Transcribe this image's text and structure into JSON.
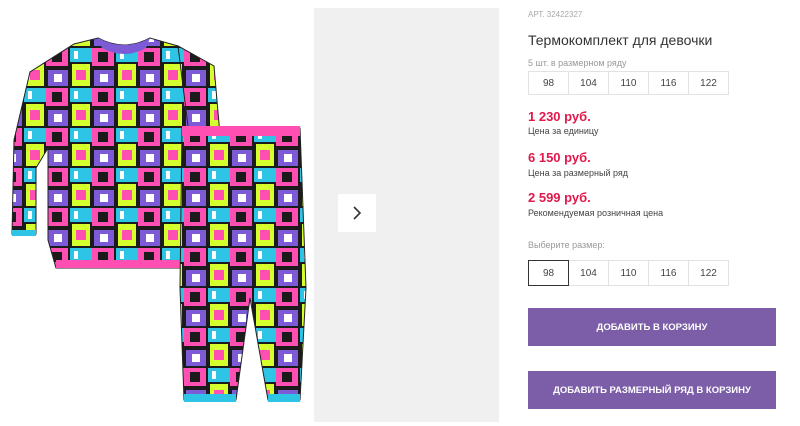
{
  "product": {
    "article": "АРТ. 32422327",
    "title": "Термокомплект для девочки"
  },
  "pack": {
    "hint": "5 шт. в размерном ряду",
    "sizes": [
      "98",
      "104",
      "110",
      "116",
      "122"
    ]
  },
  "prices": [
    {
      "value": "1 230 руб.",
      "label": "Цена за единицу"
    },
    {
      "value": "6 150 руб.",
      "label": "Цена за размерный ряд"
    },
    {
      "value": "2 599 руб.",
      "label": "Рекомендуемая розничная цена"
    }
  ],
  "size_select": {
    "hint": "Выберите размер:",
    "sizes": [
      "98",
      "104",
      "110",
      "116",
      "122"
    ],
    "selected": "98"
  },
  "buttons": {
    "add_to_cart": "ДОБАВИТЬ В КОРЗИНУ",
    "add_row_to_cart": "ДОБАВИТЬ РАЗМЕРНЫЙ РЯД В КОРЗИНУ"
  },
  "gallery": {
    "next_icon": "chevron-right-icon"
  },
  "colors": {
    "price": "#e0184b",
    "button": "#7b5ea7",
    "thumb_bg": "#f0f0f0"
  }
}
